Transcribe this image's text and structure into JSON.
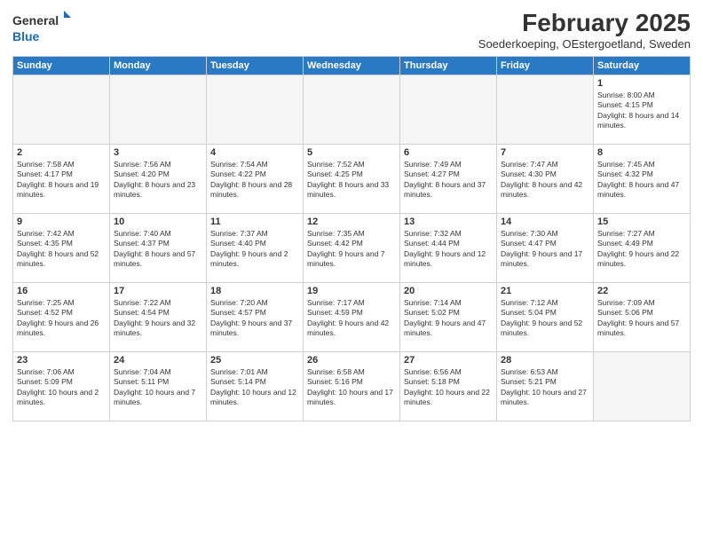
{
  "header": {
    "logo_line1": "General",
    "logo_line2": "Blue",
    "title": "February 2025",
    "subtitle": "Soederkoeping, OEstergoetland, Sweden"
  },
  "days_of_week": [
    "Sunday",
    "Monday",
    "Tuesday",
    "Wednesday",
    "Thursday",
    "Friday",
    "Saturday"
  ],
  "weeks": [
    [
      {
        "day": "",
        "text": ""
      },
      {
        "day": "",
        "text": ""
      },
      {
        "day": "",
        "text": ""
      },
      {
        "day": "",
        "text": ""
      },
      {
        "day": "",
        "text": ""
      },
      {
        "day": "",
        "text": ""
      },
      {
        "day": "1",
        "text": "Sunrise: 8:00 AM\nSunset: 4:15 PM\nDaylight: 8 hours and 14 minutes."
      }
    ],
    [
      {
        "day": "2",
        "text": "Sunrise: 7:58 AM\nSunset: 4:17 PM\nDaylight: 8 hours and 19 minutes."
      },
      {
        "day": "3",
        "text": "Sunrise: 7:56 AM\nSunset: 4:20 PM\nDaylight: 8 hours and 23 minutes."
      },
      {
        "day": "4",
        "text": "Sunrise: 7:54 AM\nSunset: 4:22 PM\nDaylight: 8 hours and 28 minutes."
      },
      {
        "day": "5",
        "text": "Sunrise: 7:52 AM\nSunset: 4:25 PM\nDaylight: 8 hours and 33 minutes."
      },
      {
        "day": "6",
        "text": "Sunrise: 7:49 AM\nSunset: 4:27 PM\nDaylight: 8 hours and 37 minutes."
      },
      {
        "day": "7",
        "text": "Sunrise: 7:47 AM\nSunset: 4:30 PM\nDaylight: 8 hours and 42 minutes."
      },
      {
        "day": "8",
        "text": "Sunrise: 7:45 AM\nSunset: 4:32 PM\nDaylight: 8 hours and 47 minutes."
      }
    ],
    [
      {
        "day": "9",
        "text": "Sunrise: 7:42 AM\nSunset: 4:35 PM\nDaylight: 8 hours and 52 minutes."
      },
      {
        "day": "10",
        "text": "Sunrise: 7:40 AM\nSunset: 4:37 PM\nDaylight: 8 hours and 57 minutes."
      },
      {
        "day": "11",
        "text": "Sunrise: 7:37 AM\nSunset: 4:40 PM\nDaylight: 9 hours and 2 minutes."
      },
      {
        "day": "12",
        "text": "Sunrise: 7:35 AM\nSunset: 4:42 PM\nDaylight: 9 hours and 7 minutes."
      },
      {
        "day": "13",
        "text": "Sunrise: 7:32 AM\nSunset: 4:44 PM\nDaylight: 9 hours and 12 minutes."
      },
      {
        "day": "14",
        "text": "Sunrise: 7:30 AM\nSunset: 4:47 PM\nDaylight: 9 hours and 17 minutes."
      },
      {
        "day": "15",
        "text": "Sunrise: 7:27 AM\nSunset: 4:49 PM\nDaylight: 9 hours and 22 minutes."
      }
    ],
    [
      {
        "day": "16",
        "text": "Sunrise: 7:25 AM\nSunset: 4:52 PM\nDaylight: 9 hours and 26 minutes."
      },
      {
        "day": "17",
        "text": "Sunrise: 7:22 AM\nSunset: 4:54 PM\nDaylight: 9 hours and 32 minutes."
      },
      {
        "day": "18",
        "text": "Sunrise: 7:20 AM\nSunset: 4:57 PM\nDaylight: 9 hours and 37 minutes."
      },
      {
        "day": "19",
        "text": "Sunrise: 7:17 AM\nSunset: 4:59 PM\nDaylight: 9 hours and 42 minutes."
      },
      {
        "day": "20",
        "text": "Sunrise: 7:14 AM\nSunset: 5:02 PM\nDaylight: 9 hours and 47 minutes."
      },
      {
        "day": "21",
        "text": "Sunrise: 7:12 AM\nSunset: 5:04 PM\nDaylight: 9 hours and 52 minutes."
      },
      {
        "day": "22",
        "text": "Sunrise: 7:09 AM\nSunset: 5:06 PM\nDaylight: 9 hours and 57 minutes."
      }
    ],
    [
      {
        "day": "23",
        "text": "Sunrise: 7:06 AM\nSunset: 5:09 PM\nDaylight: 10 hours and 2 minutes."
      },
      {
        "day": "24",
        "text": "Sunrise: 7:04 AM\nSunset: 5:11 PM\nDaylight: 10 hours and 7 minutes."
      },
      {
        "day": "25",
        "text": "Sunrise: 7:01 AM\nSunset: 5:14 PM\nDaylight: 10 hours and 12 minutes."
      },
      {
        "day": "26",
        "text": "Sunrise: 6:58 AM\nSunset: 5:16 PM\nDaylight: 10 hours and 17 minutes."
      },
      {
        "day": "27",
        "text": "Sunrise: 6:56 AM\nSunset: 5:18 PM\nDaylight: 10 hours and 22 minutes."
      },
      {
        "day": "28",
        "text": "Sunrise: 6:53 AM\nSunset: 5:21 PM\nDaylight: 10 hours and 27 minutes."
      },
      {
        "day": "",
        "text": ""
      }
    ]
  ]
}
